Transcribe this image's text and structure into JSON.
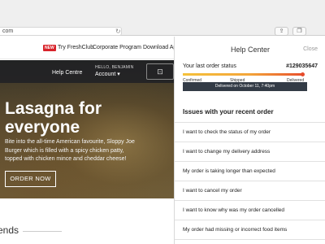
{
  "browser": {
    "url": "com",
    "reload_icon": "↻",
    "share_icon": "⇪",
    "tabs_icon": "❐"
  },
  "site_nav": {
    "new_badge": "NEW",
    "links": [
      "Try FreshClub",
      "Corporate Program",
      "Download Ap"
    ]
  },
  "hero": {
    "help_link": "Help Centre",
    "greeting": "HELLO, BENJAMIN",
    "account": "Account ▾",
    "cart_icon": "⊡",
    "title": "Lasagna for everyone",
    "description": "Bite into the all-time American favourite, Sloppy Joe Burger which is filled with a spicy chicken patty, topped with chicken mince and cheddar cheese!",
    "cta": "ORDER NOW"
  },
  "section": {
    "partial_heading": "ends"
  },
  "help_center": {
    "title": "Help Center",
    "close_label": "Close",
    "order": {
      "status_label": "Your last order status",
      "number": "#129035647",
      "steps": [
        "Confirmed",
        "Shipped",
        "Delivered"
      ],
      "progress_fraction": 1.0,
      "delivered_message": "Delivered on October 11, 7:40pm"
    },
    "issues_heading": "Issues with your recent order",
    "issues": [
      "I want to check the status of my order",
      "I want to change my delivery address",
      "My order is taking longer than expected",
      "I want to cancel my order",
      "I want to know why was my order cancelled",
      "My order had missing or incorrect food items"
    ]
  },
  "colors": {
    "badge_red": "#d8232a",
    "progress_start": "#f5c13b",
    "progress_end": "#e8512d",
    "delivered_box": "#333b46"
  }
}
